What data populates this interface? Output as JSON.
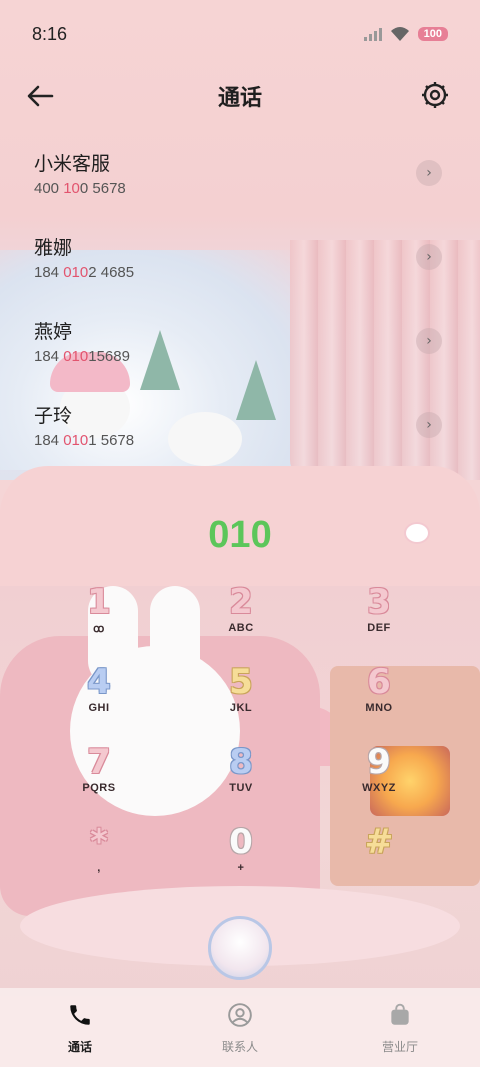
{
  "status_bar": {
    "time": "8:16",
    "battery": "100"
  },
  "header": {
    "title": "通话"
  },
  "contacts": [
    {
      "name": "小米客服",
      "number_pre": "400 ",
      "number_hl": "10",
      "number_post": "0 5678"
    },
    {
      "name": "雅娜",
      "number_pre": "184 ",
      "number_hl": "010",
      "number_post": "2 4685"
    },
    {
      "name": "燕婷",
      "number_pre": "184 ",
      "number_hl": "010",
      "number_post": "15689"
    },
    {
      "name": "子玲",
      "number_pre": "184 ",
      "number_hl": "010",
      "number_post": "1 5678"
    }
  ],
  "dialer": {
    "entered_number": "010",
    "keys": [
      {
        "digit": "1",
        "letters": "ꝏ"
      },
      {
        "digit": "2",
        "letters": "ABC"
      },
      {
        "digit": "3",
        "letters": "DEF"
      },
      {
        "digit": "4",
        "letters": "GHI"
      },
      {
        "digit": "5",
        "letters": "JKL"
      },
      {
        "digit": "6",
        "letters": "MNO"
      },
      {
        "digit": "7",
        "letters": "PQRS"
      },
      {
        "digit": "8",
        "letters": "TUV"
      },
      {
        "digit": "9",
        "letters": "WXYZ"
      },
      {
        "digit": "*",
        "letters": ","
      },
      {
        "digit": "0",
        "letters": "+"
      },
      {
        "digit": "#",
        "letters": ""
      }
    ]
  },
  "bottom_nav": [
    {
      "label": "通话",
      "active": true
    },
    {
      "label": "联系人",
      "active": false
    },
    {
      "label": "营业厅",
      "active": false
    }
  ],
  "colors": {
    "accent_pink": "#e2546e",
    "dial_green": "#5cc65a",
    "background": "#f5d5d6"
  },
  "icons": [
    "back-arrow-icon",
    "settings-gear-icon",
    "chevron-right-icon",
    "phone-icon",
    "contacts-icon",
    "store-bag-icon",
    "wifi-icon",
    "signal-icon"
  ]
}
